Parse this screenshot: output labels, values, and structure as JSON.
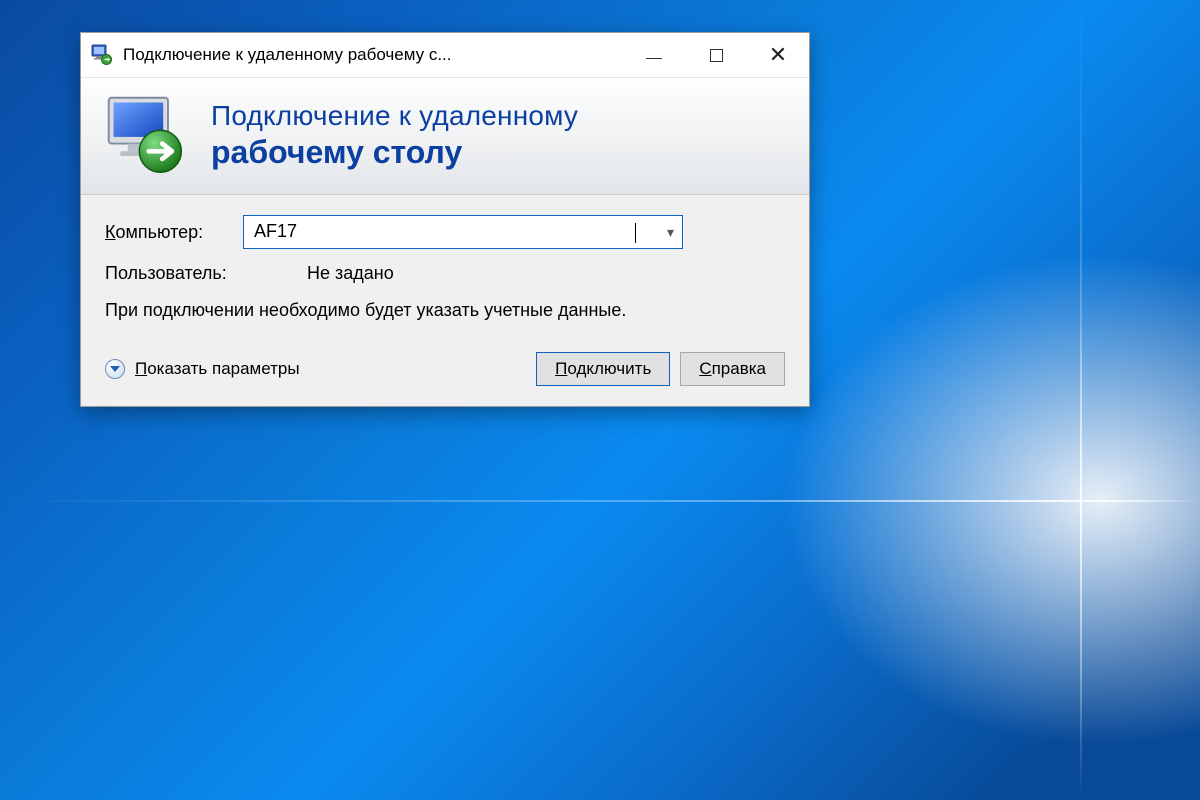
{
  "titlebar": {
    "title": "Подключение к удаленному рабочему с..."
  },
  "header": {
    "line1": "Подключение к удаленному",
    "line2": "рабочему столу"
  },
  "form": {
    "computer_label_pre": "К",
    "computer_label_rest": "омпьютер:",
    "computer_value": "AF17",
    "user_label": "Пользователь:",
    "user_value": "Не задано",
    "hint": "При подключении необходимо будет указать учетные данные."
  },
  "footer": {
    "show_options_pre": "П",
    "show_options_rest": "оказать параметры",
    "connect_pre": "П",
    "connect_rest": "одключить",
    "help_pre": "С",
    "help_rest": "правка"
  }
}
